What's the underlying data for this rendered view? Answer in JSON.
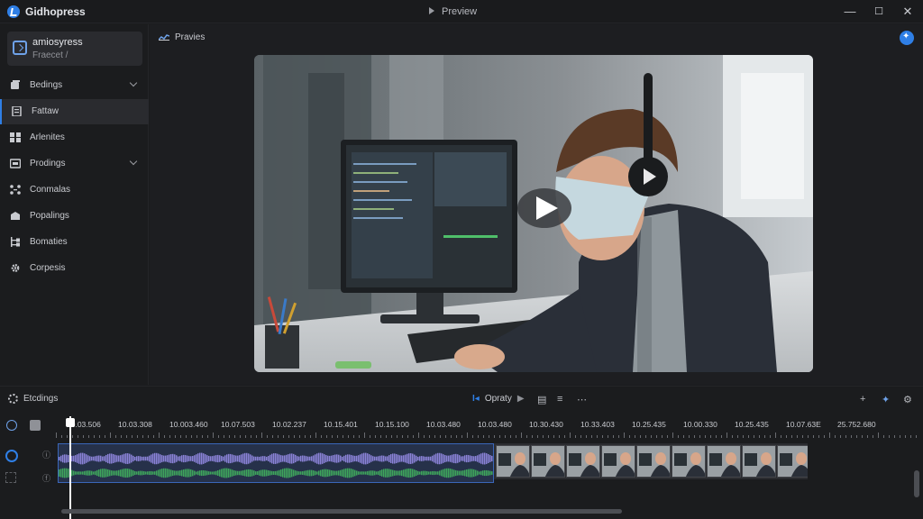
{
  "window": {
    "app_title": "Gidhopress",
    "center_title": "Preview",
    "minimize": "—",
    "maximize": "☐",
    "close": "✕"
  },
  "sidebar": {
    "project": {
      "name": "amiosyress",
      "subtitle": "Fraecet /"
    },
    "items": [
      {
        "label": "Bedings",
        "icon": "layers-icon",
        "expandable": true,
        "active": false
      },
      {
        "label": "Fattaw",
        "icon": "document-icon",
        "expandable": false,
        "active": true
      },
      {
        "label": "Arlenites",
        "icon": "grid-icon",
        "expandable": false,
        "active": false
      },
      {
        "label": "Prodings",
        "icon": "media-icon",
        "expandable": true,
        "active": false
      },
      {
        "label": "Conmalas",
        "icon": "nodes-icon",
        "expandable": false,
        "active": false
      },
      {
        "label": "Popalings",
        "icon": "stack-icon",
        "expandable": false,
        "active": false
      },
      {
        "label": "Bomaties",
        "icon": "tree-icon",
        "expandable": false,
        "active": false
      },
      {
        "label": "Corpesis",
        "icon": "gear-icon",
        "expandable": false,
        "active": false
      }
    ]
  },
  "preview": {
    "tab_label": "Pravies"
  },
  "timeline": {
    "title": "Etcdings",
    "center_label": "Opraty",
    "ruler_times": [
      "10.03.506",
      "10.03.308",
      "10.003.460",
      "10.07.503",
      "10.02.237",
      "10.15.401",
      "10.15.100",
      "10.03.480",
      "10.03.480",
      "10.30.430",
      "10.33.403",
      "10.25.435",
      "10.00.330",
      "10.25.435",
      "10.07.63E",
      "25.752.680"
    ],
    "accent_color": "#2f7fe6",
    "audio_color": "#8b82d8",
    "audio_color2": "#3fa65c"
  }
}
